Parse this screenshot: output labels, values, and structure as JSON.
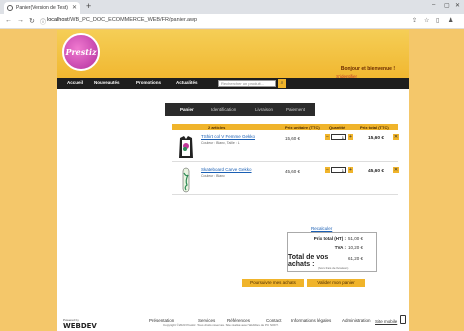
{
  "browser": {
    "tab_title": "Panier(Version de Test)",
    "url_host": "localhost",
    "url_path": "/WB_PC_DOC_ECOMMERCE_WEB/FR/panier.awp"
  },
  "header": {
    "logo_text": "Prestiz",
    "welcome": "Bonjour et bienvenue !",
    "identify_link": "S'identifier"
  },
  "menu": {
    "items": [
      "Accueil",
      "Nouveautés",
      "Promotions",
      "Actualités"
    ],
    "search_placeholder": "Rechercher un produit..."
  },
  "steps": [
    "Panier",
    "Identification",
    "Livraison",
    "Paiement"
  ],
  "cart": {
    "columns": {
      "articles": "2 articles",
      "unit_price": "Prix unitaire (TTC)",
      "quantity": "Quantité",
      "total_price": "Prix total (TTC)"
    },
    "rows": [
      {
        "name": "TShirt col V Femme Gekko",
        "sub": "Couleur : Blanc, Taille : L",
        "unit": "15,60 €",
        "qty": "1",
        "total": "15,60 €"
      },
      {
        "name": "Skateboard Carve Gekko",
        "sub": "Couleur : Blanc",
        "unit": "45,60 €",
        "qty": "1",
        "total": "45,60 €"
      }
    ]
  },
  "totals": {
    "recalc_link": "Recalculer",
    "ht_label": "Prix total (HT) :",
    "ht_value": "51,00 €",
    "tva_label": "TVA :",
    "tva_value": "10,20 €",
    "grand_label": "Total de vos achats :",
    "grand_value": "61,20 €",
    "note": "(hors frais de livraison)"
  },
  "buttons": {
    "continue": "Poursuivre mes achats",
    "validate": "Valider mon panier"
  },
  "footer": {
    "powered_by": "Powered by",
    "webdev": "WEBDEV",
    "links": [
      "Présentation",
      "Services",
      "Références",
      "Contact",
      "Informations légales",
      "Administration"
    ],
    "copyright": "Copyright ©2023 Prestiz. Tous droits réservés. Site réalisé avec WebDev de PC SOFT.",
    "mobile": "Site mobile"
  }
}
